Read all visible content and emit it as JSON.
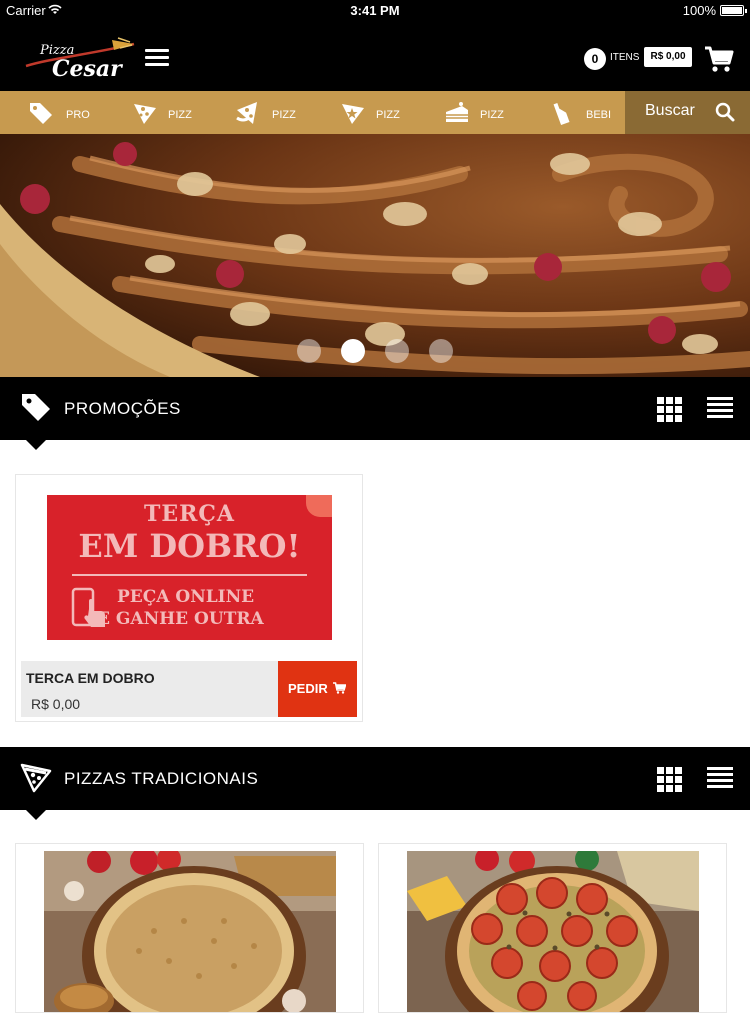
{
  "status_bar": {
    "carrier": "Carrier",
    "time": "3:41 PM",
    "battery": "100%",
    "battery_level": 1.0
  },
  "header": {
    "logo": "pizza-cesar-logo",
    "cart_count": "0",
    "cart_label": "ITENS",
    "cart_total": "R$ 0,00"
  },
  "categories": [
    {
      "label": "PRO",
      "icon": "tag-icon"
    },
    {
      "label": "PIZZ",
      "icon": "pizza-slice-icon"
    },
    {
      "label": "PIZZ",
      "icon": "pizza-slice-icon"
    },
    {
      "label": "PIZZ",
      "icon": "pizza-star-icon"
    },
    {
      "label": "PIZZ",
      "icon": "cake-icon"
    },
    {
      "label": "BEBI",
      "icon": "bottle-icon"
    }
  ],
  "search": {
    "label": "Buscar"
  },
  "carousel": {
    "slide_count": 4,
    "active_index": 1
  },
  "sections": {
    "promocoes": {
      "title": "PROMOÇÕES",
      "icon": "tag-icon"
    },
    "pizzas": {
      "title": "PIZZAS TRADICIONAIS",
      "icon": "pizza-slice-icon"
    }
  },
  "promo_card": {
    "banner": {
      "line1": "TERÇA",
      "line2": "EM DOBRO!",
      "line3": "PEÇA ONLINE",
      "line4": "E GANHE OUTRA"
    },
    "name": "TERCA EM DOBRO",
    "price": "R$ 0,00",
    "button": "PEDIR"
  },
  "colors": {
    "header_bg": "#000000",
    "category_bar": "#c79a4f",
    "search_bg": "#8a6a34",
    "order_button": "#e03312",
    "promo_banner": "#d8222a"
  }
}
